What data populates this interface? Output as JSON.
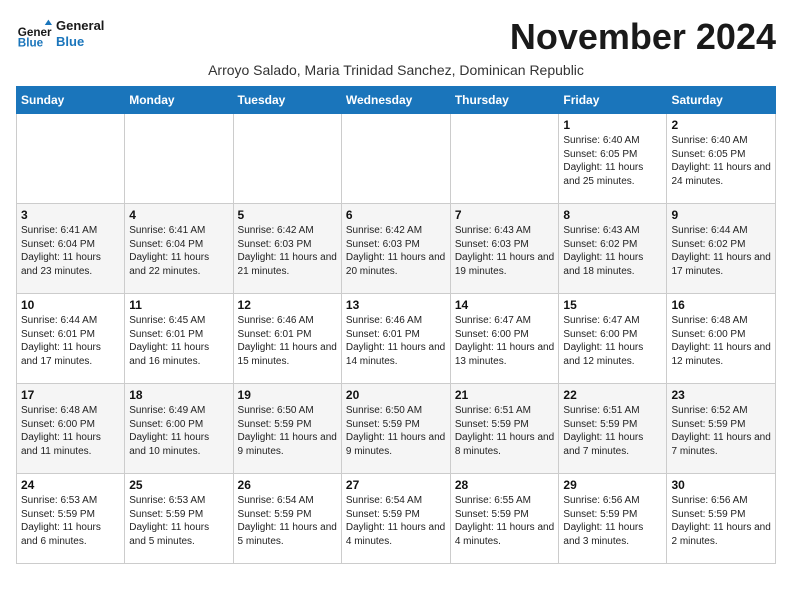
{
  "header": {
    "logo_general": "General",
    "logo_blue": "Blue",
    "month_title": "November 2024",
    "subtitle": "Arroyo Salado, Maria Trinidad Sanchez, Dominican Republic"
  },
  "weekdays": [
    "Sunday",
    "Monday",
    "Tuesday",
    "Wednesday",
    "Thursday",
    "Friday",
    "Saturday"
  ],
  "weeks": [
    [
      {
        "day": "",
        "info": ""
      },
      {
        "day": "",
        "info": ""
      },
      {
        "day": "",
        "info": ""
      },
      {
        "day": "",
        "info": ""
      },
      {
        "day": "",
        "info": ""
      },
      {
        "day": "1",
        "info": "Sunrise: 6:40 AM\nSunset: 6:05 PM\nDaylight: 11 hours and 25 minutes."
      },
      {
        "day": "2",
        "info": "Sunrise: 6:40 AM\nSunset: 6:05 PM\nDaylight: 11 hours and 24 minutes."
      }
    ],
    [
      {
        "day": "3",
        "info": "Sunrise: 6:41 AM\nSunset: 6:04 PM\nDaylight: 11 hours and 23 minutes."
      },
      {
        "day": "4",
        "info": "Sunrise: 6:41 AM\nSunset: 6:04 PM\nDaylight: 11 hours and 22 minutes."
      },
      {
        "day": "5",
        "info": "Sunrise: 6:42 AM\nSunset: 6:03 PM\nDaylight: 11 hours and 21 minutes."
      },
      {
        "day": "6",
        "info": "Sunrise: 6:42 AM\nSunset: 6:03 PM\nDaylight: 11 hours and 20 minutes."
      },
      {
        "day": "7",
        "info": "Sunrise: 6:43 AM\nSunset: 6:03 PM\nDaylight: 11 hours and 19 minutes."
      },
      {
        "day": "8",
        "info": "Sunrise: 6:43 AM\nSunset: 6:02 PM\nDaylight: 11 hours and 18 minutes."
      },
      {
        "day": "9",
        "info": "Sunrise: 6:44 AM\nSunset: 6:02 PM\nDaylight: 11 hours and 17 minutes."
      }
    ],
    [
      {
        "day": "10",
        "info": "Sunrise: 6:44 AM\nSunset: 6:01 PM\nDaylight: 11 hours and 17 minutes."
      },
      {
        "day": "11",
        "info": "Sunrise: 6:45 AM\nSunset: 6:01 PM\nDaylight: 11 hours and 16 minutes."
      },
      {
        "day": "12",
        "info": "Sunrise: 6:46 AM\nSunset: 6:01 PM\nDaylight: 11 hours and 15 minutes."
      },
      {
        "day": "13",
        "info": "Sunrise: 6:46 AM\nSunset: 6:01 PM\nDaylight: 11 hours and 14 minutes."
      },
      {
        "day": "14",
        "info": "Sunrise: 6:47 AM\nSunset: 6:00 PM\nDaylight: 11 hours and 13 minutes."
      },
      {
        "day": "15",
        "info": "Sunrise: 6:47 AM\nSunset: 6:00 PM\nDaylight: 11 hours and 12 minutes."
      },
      {
        "day": "16",
        "info": "Sunrise: 6:48 AM\nSunset: 6:00 PM\nDaylight: 11 hours and 12 minutes."
      }
    ],
    [
      {
        "day": "17",
        "info": "Sunrise: 6:48 AM\nSunset: 6:00 PM\nDaylight: 11 hours and 11 minutes."
      },
      {
        "day": "18",
        "info": "Sunrise: 6:49 AM\nSunset: 6:00 PM\nDaylight: 11 hours and 10 minutes."
      },
      {
        "day": "19",
        "info": "Sunrise: 6:50 AM\nSunset: 5:59 PM\nDaylight: 11 hours and 9 minutes."
      },
      {
        "day": "20",
        "info": "Sunrise: 6:50 AM\nSunset: 5:59 PM\nDaylight: 11 hours and 9 minutes."
      },
      {
        "day": "21",
        "info": "Sunrise: 6:51 AM\nSunset: 5:59 PM\nDaylight: 11 hours and 8 minutes."
      },
      {
        "day": "22",
        "info": "Sunrise: 6:51 AM\nSunset: 5:59 PM\nDaylight: 11 hours and 7 minutes."
      },
      {
        "day": "23",
        "info": "Sunrise: 6:52 AM\nSunset: 5:59 PM\nDaylight: 11 hours and 7 minutes."
      }
    ],
    [
      {
        "day": "24",
        "info": "Sunrise: 6:53 AM\nSunset: 5:59 PM\nDaylight: 11 hours and 6 minutes."
      },
      {
        "day": "25",
        "info": "Sunrise: 6:53 AM\nSunset: 5:59 PM\nDaylight: 11 hours and 5 minutes."
      },
      {
        "day": "26",
        "info": "Sunrise: 6:54 AM\nSunset: 5:59 PM\nDaylight: 11 hours and 5 minutes."
      },
      {
        "day": "27",
        "info": "Sunrise: 6:54 AM\nSunset: 5:59 PM\nDaylight: 11 hours and 4 minutes."
      },
      {
        "day": "28",
        "info": "Sunrise: 6:55 AM\nSunset: 5:59 PM\nDaylight: 11 hours and 4 minutes."
      },
      {
        "day": "29",
        "info": "Sunrise: 6:56 AM\nSunset: 5:59 PM\nDaylight: 11 hours and 3 minutes."
      },
      {
        "day": "30",
        "info": "Sunrise: 6:56 AM\nSunset: 5:59 PM\nDaylight: 11 hours and 2 minutes."
      }
    ]
  ]
}
